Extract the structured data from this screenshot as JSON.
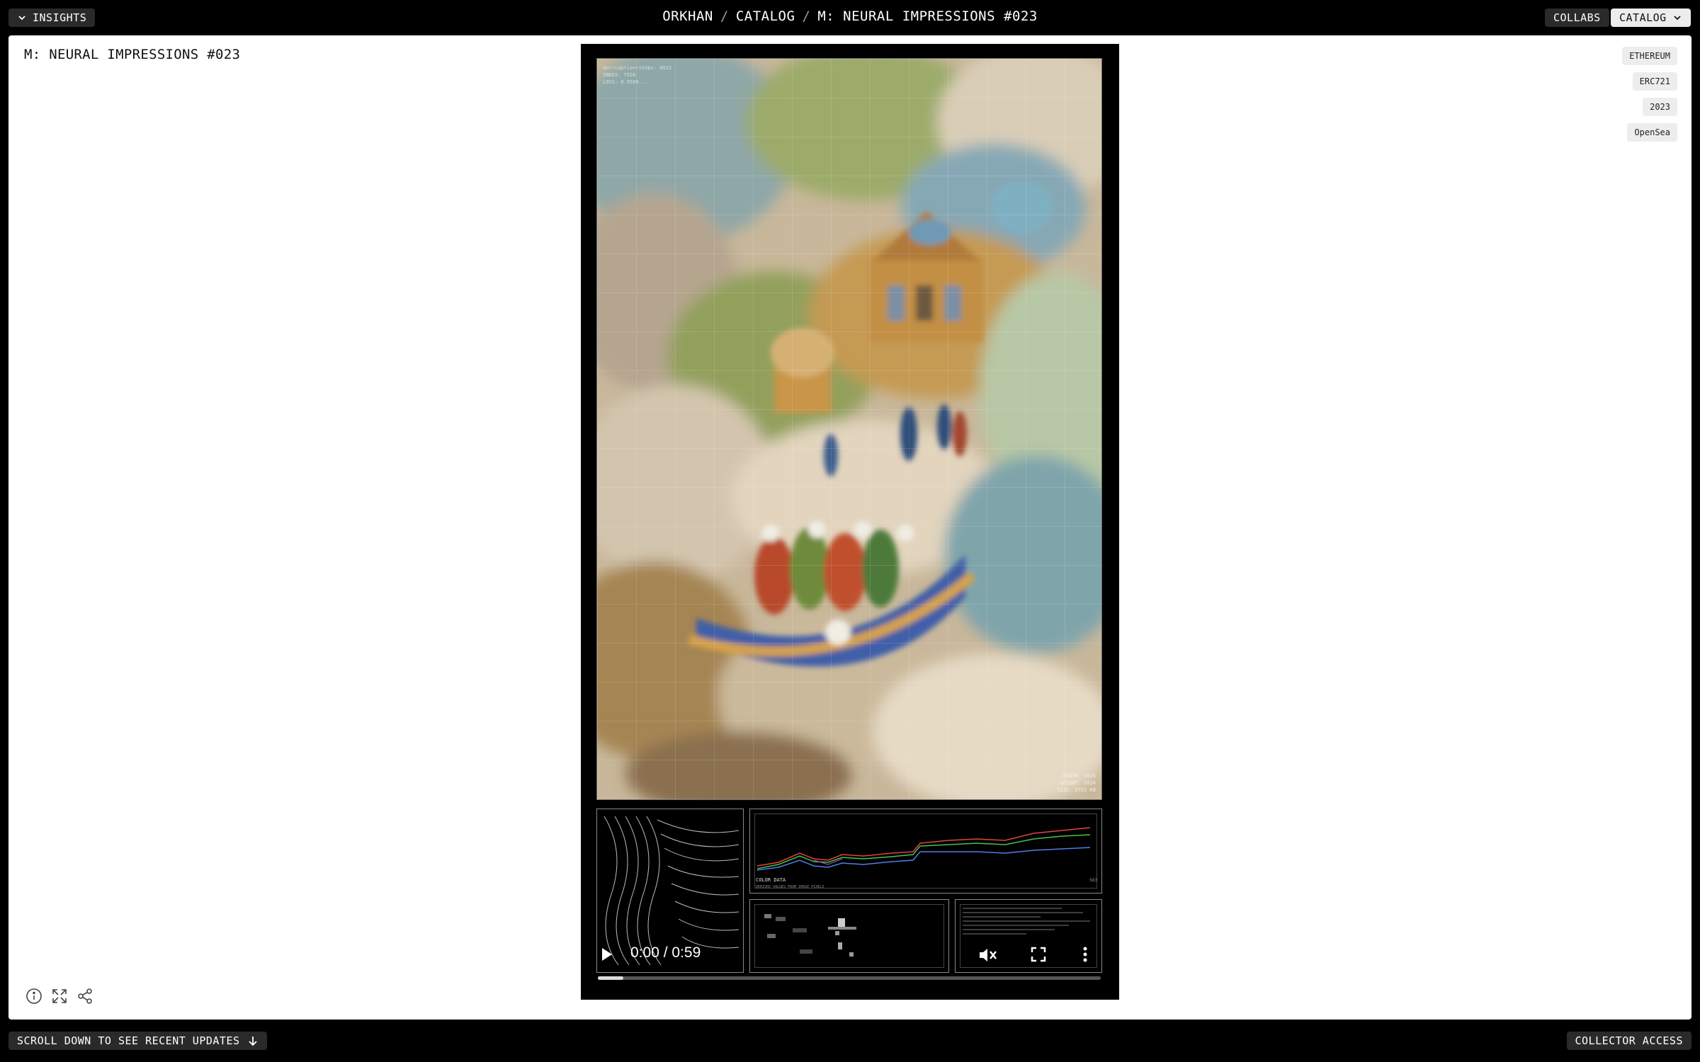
{
  "topbar": {
    "insights_label": "INSIGHTS",
    "breadcrumb": [
      "ORKHAN",
      "CATALOG",
      "M: NEURAL IMPRESSIONS #023"
    ],
    "breadcrumb_sep": "/",
    "collabs_label": "COLLABS",
    "catalog_label": "CATALOG"
  },
  "artwork": {
    "title": "M: NEURAL IMPRESSIONS #023",
    "tags": [
      "ETHEREUM",
      "ERC721",
      "2023",
      "OpenSea"
    ],
    "overlay_top_left": [
      "dorrcaptionrsteps: 0023",
      "INDEX: 7526",
      "LOSS: 0.9509..."
    ],
    "overlay_bottom_right": [
      "WIDTH: 1024",
      "HEIGHT: 1024",
      "SIZE: 3722 KB"
    ],
    "color_data_label": "COLOR DATA",
    "color_data_sub": "DERIVED VALUES FROM IMAGE PIXELS",
    "color_data_number": "563"
  },
  "video": {
    "time": "0:00 / 0:59",
    "progress": 0.05
  },
  "bottombar": {
    "scroll_hint": "SCROLL DOWN TO SEE RECENT UPDATES",
    "collector_label": "COLLECTOR ACCESS"
  },
  "icons": {
    "insights": "chevron-down-icon",
    "catalog": "chevron-down-icon",
    "info": "info-icon",
    "expand": "expand-icon",
    "share": "share-icon",
    "scroll": "arrow-down-icon",
    "play": "play-icon",
    "mute": "volume-muted-icon",
    "fullscreen": "fullscreen-icon",
    "more": "more-vertical-icon"
  }
}
